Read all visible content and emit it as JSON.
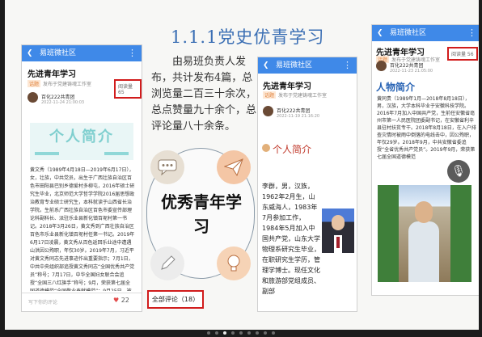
{
  "slide": {
    "title": "1.1.1党史优青学习",
    "description": "由易班负责人发布，共计发布4篇，总浏览量二百三十余次，总点赞量九十余个，总评论量八十余条。",
    "graphic_text": "优秀青年学习",
    "all_comments": "全部评论（18）"
  },
  "phone1": {
    "app_name": "易班微社区",
    "post_title": "先进青年学习",
    "tags": [
      "话题",
      "发布于党建铸魂工作室"
    ],
    "user": "百化222共青团",
    "date": "2022-11-24 21:00:03",
    "views": "阅读量 65",
    "banner_title": "个人简介",
    "body": "黄文秀（1989年4月18日—2019年6月17日），女，壮族，中共党员，出生于广西壮族自治区百色市田阳县巴别乡德爱村多柳屯，2016年硕士研究生毕业，北京师范大学哲学学院2016届思想政治教育专业硕士研究生，本科就读于山西省长治学院。生前系广西壮族自治区百色市委宣传部理论科副科长、派驻乐业县新化镇百坭村第一书记。2018年3月26日，黄文秀到广西壮族自治区百色市乐业县新化镇百坭村任第一书记。2019年6月17日凌晨，黄文秀从百色返回乐业途中遭遇山洪因公殉职，年仅30岁。2019年7月，习近平对黄文秀同志先进事迹作出重要指示；7月1日，中共中央组织部追授黄文秀同志“全国优秀共产党员”称号；7月17日，中华全国妇女联合会追授“全国三八红旗手”称号；9月，荣获第七届全国道德模范“全国敬业奉献模范”；9月25日，被授予“最美奋斗者”称号；10月，被追授为全国脱贫攻坚奖“奋进奖”，2020年5月17日，入选感动中国2019年度人物，被评为“时代楷模”。",
    "comment_placeholder": "写下你的评论",
    "likes": "22"
  },
  "phone2": {
    "app_name": "易班微社区",
    "post_title": "先进青年学习",
    "tags": [
      "话题",
      "发布于党建铸魂工作室"
    ],
    "user": "百化222共青团",
    "date": "2022-11-19 21:16:20",
    "section": "个人简介",
    "bio": "李群，男，汉族，1962年2月生，山东威海人，1983年7月参加工作，1984年5月加入中国共产党，山东大学物理系研究生毕业，在职研究生学历，管理学博士。现任文化和旅游部党组成员、副部"
  },
  "phone3": {
    "app_name": "易班微社区",
    "post_title": "先进青年学习",
    "tags": [
      "话题",
      "发布于党建铸魂工作室"
    ],
    "user": "百化222共青团",
    "date": "2022-11-23 21:05:00",
    "views": "阅读量 56",
    "heading": "人物简介",
    "body": "黄同贵（1989年1月—2018年8月18日），男，汉族，大学本科毕业于安徽科技学院。2016年7月加入中国共产党，生前任安徽省亳州市第一人民医院团委副书记，在安徽省利辛县驻村扶贫专干。2018年8月18日，在入户排查灾情时被雨中倒落的电线击中，因公殉职，年仅29岁。2018年9月，中共安徽省委追授“全省优秀共产党员”。2019年9月，荣获第七届全国道德模范"
  },
  "pagination": {
    "count": 9,
    "active_index": 2
  }
}
